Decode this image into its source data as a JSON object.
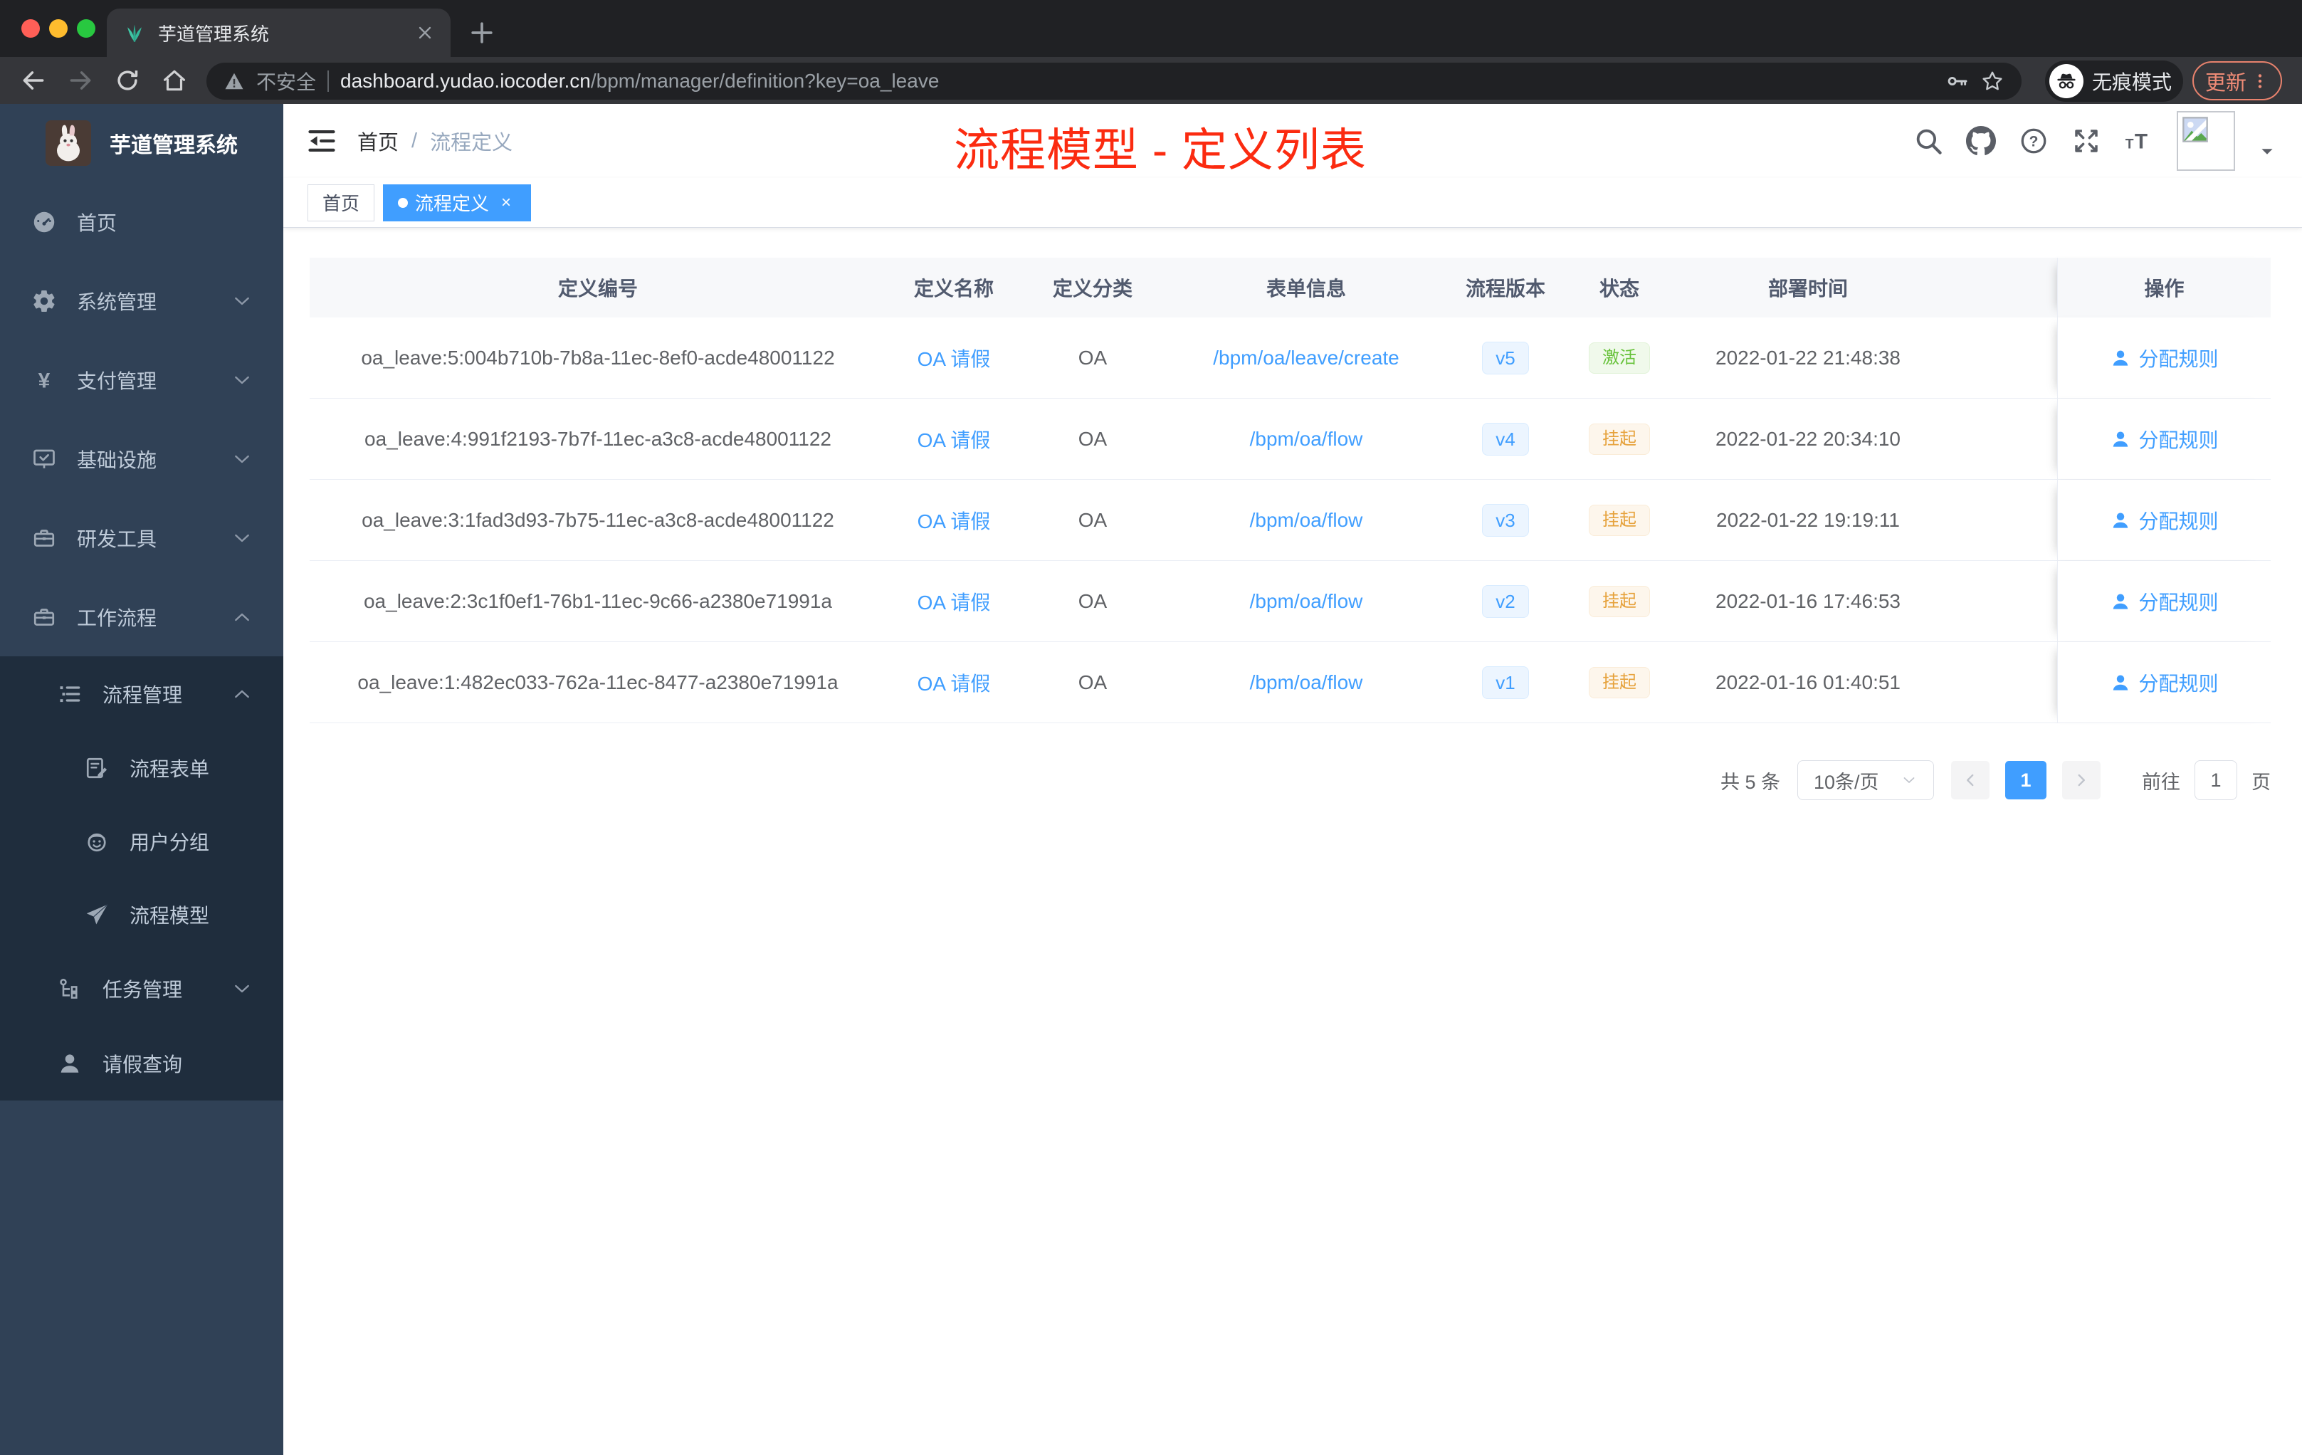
{
  "browser": {
    "tab_title": "芋道管理系统",
    "security_label": "不安全",
    "url_domain": "dashboard.yudao.iocoder.cn",
    "url_path": "/bpm/manager/definition?key=oa_leave",
    "incognito_label": "无痕模式",
    "update_label": "更新"
  },
  "sidebar": {
    "app_title": "芋道管理系统",
    "items": [
      {
        "key": "home",
        "label": "首页",
        "icon": "dashboard-icon",
        "level": 1,
        "submenu": false,
        "chevron": ""
      },
      {
        "key": "system",
        "label": "系统管理",
        "icon": "gear-icon",
        "level": 1,
        "submenu": false,
        "chevron": "down"
      },
      {
        "key": "payment",
        "label": "支付管理",
        "icon": "yen-icon",
        "level": 1,
        "submenu": false,
        "chevron": "down"
      },
      {
        "key": "infra",
        "label": "基础设施",
        "icon": "monitor-icon",
        "level": 1,
        "submenu": false,
        "chevron": "down"
      },
      {
        "key": "devtools",
        "label": "研发工具",
        "icon": "toolbox-icon",
        "level": 1,
        "submenu": false,
        "chevron": "down"
      },
      {
        "key": "workflow",
        "label": "工作流程",
        "icon": "briefcase-icon",
        "level": 1,
        "submenu": false,
        "chevron": "up"
      },
      {
        "key": "process-mgmt",
        "label": "流程管理",
        "icon": "list-tree-icon",
        "level": 2,
        "submenu": true,
        "chevron": "up"
      },
      {
        "key": "process-form",
        "label": "流程表单",
        "icon": "form-icon",
        "level": 3,
        "submenu": true,
        "chevron": ""
      },
      {
        "key": "user-group",
        "label": "用户分组",
        "icon": "face-icon",
        "level": 3,
        "submenu": true,
        "chevron": ""
      },
      {
        "key": "process-model",
        "label": "流程模型",
        "icon": "paper-plane-icon",
        "level": 3,
        "submenu": true,
        "chevron": ""
      },
      {
        "key": "task-mgmt",
        "label": "任务管理",
        "icon": "task-tree-icon",
        "level": 2,
        "submenu": true,
        "chevron": "down"
      },
      {
        "key": "leave-query",
        "label": "请假查询",
        "icon": "user-icon",
        "level": 2,
        "submenu": true,
        "chevron": ""
      }
    ]
  },
  "header": {
    "breadcrumb_home": "首页",
    "breadcrumb_sep": "/",
    "breadcrumb_current": "流程定义",
    "annotation": "流程模型 - 定义列表",
    "right_icons": [
      "search-icon",
      "github-icon",
      "help-icon",
      "fullscreen-icon",
      "font-size-icon"
    ]
  },
  "tags": {
    "home": {
      "label": "首页"
    },
    "active": {
      "label": "流程定义",
      "close": "×"
    }
  },
  "table": {
    "columns": [
      "定义编号",
      "定义名称",
      "定义分类",
      "表单信息",
      "流程版本",
      "状态",
      "部署时间",
      "操作"
    ],
    "action_label": "分配规则",
    "rows": [
      {
        "id": "oa_leave:5:004b710b-7b8a-11ec-8ef0-acde48001122",
        "name": "OA 请假",
        "category": "OA",
        "form": "/bpm/oa/leave/create",
        "version": "v5",
        "status": "激活",
        "status_type": "success",
        "deploy_time": "2022-01-22 21:48:38"
      },
      {
        "id": "oa_leave:4:991f2193-7b7f-11ec-a3c8-acde48001122",
        "name": "OA 请假",
        "category": "OA",
        "form": "/bpm/oa/flow",
        "version": "v4",
        "status": "挂起",
        "status_type": "warning",
        "deploy_time": "2022-01-22 20:34:10"
      },
      {
        "id": "oa_leave:3:1fad3d93-7b75-11ec-a3c8-acde48001122",
        "name": "OA 请假",
        "category": "OA",
        "form": "/bpm/oa/flow",
        "version": "v3",
        "status": "挂起",
        "status_type": "warning",
        "deploy_time": "2022-01-22 19:19:11"
      },
      {
        "id": "oa_leave:2:3c1f0ef1-76b1-11ec-9c66-a2380e71991a",
        "name": "OA 请假",
        "category": "OA",
        "form": "/bpm/oa/flow",
        "version": "v2",
        "status": "挂起",
        "status_type": "warning",
        "deploy_time": "2022-01-16 17:46:53"
      },
      {
        "id": "oa_leave:1:482ec033-762a-11ec-8477-a2380e71991a",
        "name": "OA 请假",
        "category": "OA",
        "form": "/bpm/oa/flow",
        "version": "v1",
        "status": "挂起",
        "status_type": "warning",
        "deploy_time": "2022-01-16 01:40:51"
      }
    ]
  },
  "pagination": {
    "total": "共 5 条",
    "page_size": "10条/页",
    "current_page": "1",
    "goto_label": "前往",
    "goto_value": "1",
    "page_suffix": "页"
  },
  "colors": {
    "accent": "#409eff",
    "success": "#67c23a",
    "warning": "#e6a23c",
    "annotation_red": "#fb2b10",
    "sidebar_bg": "#304156",
    "submenu_bg": "#1f2d3d",
    "traffic_red": "#ff5f57",
    "traffic_yellow": "#febc2e",
    "traffic_green": "#28c840"
  }
}
